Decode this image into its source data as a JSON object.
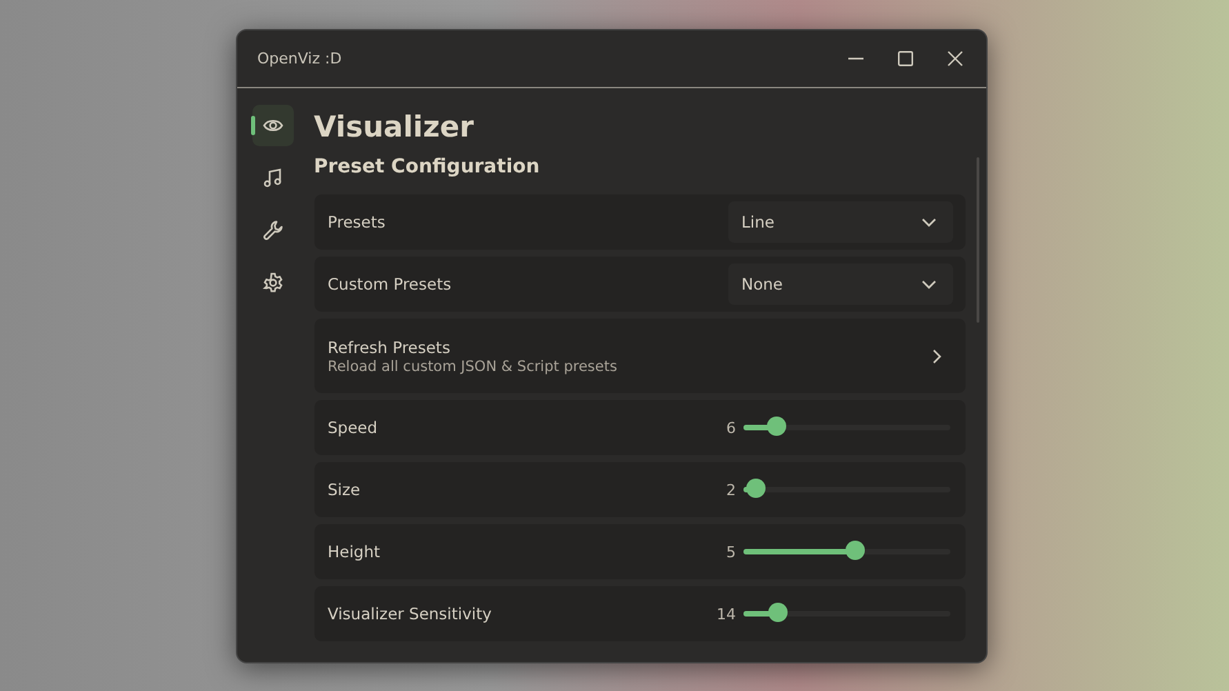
{
  "window": {
    "title": "OpenViz :D"
  },
  "sidebar": {
    "items": [
      {
        "kind": "eye",
        "selected": true
      },
      {
        "kind": "music",
        "selected": false
      },
      {
        "kind": "wrench",
        "selected": false
      },
      {
        "kind": "gear",
        "selected": false
      }
    ]
  },
  "page": {
    "title": "Visualizer",
    "section": "Preset Configuration"
  },
  "settings": [
    {
      "kind": "dropdown",
      "label": "Presets",
      "value": "Line"
    },
    {
      "kind": "dropdown",
      "label": "Custom Presets",
      "value": "None"
    },
    {
      "kind": "link",
      "label": "Refresh Presets",
      "description": "Reload all custom JSON & Script presets"
    },
    {
      "kind": "slider",
      "label": "Speed",
      "reading": "6",
      "level": 0.16
    },
    {
      "kind": "slider",
      "label": "Size",
      "reading": "2",
      "level": 0.06
    },
    {
      "kind": "slider",
      "label": "Height",
      "reading": "5",
      "level": 0.54
    },
    {
      "kind": "slider",
      "label": "Visualizer Sensitivity",
      "reading": "14",
      "level": 0.17
    }
  ]
}
